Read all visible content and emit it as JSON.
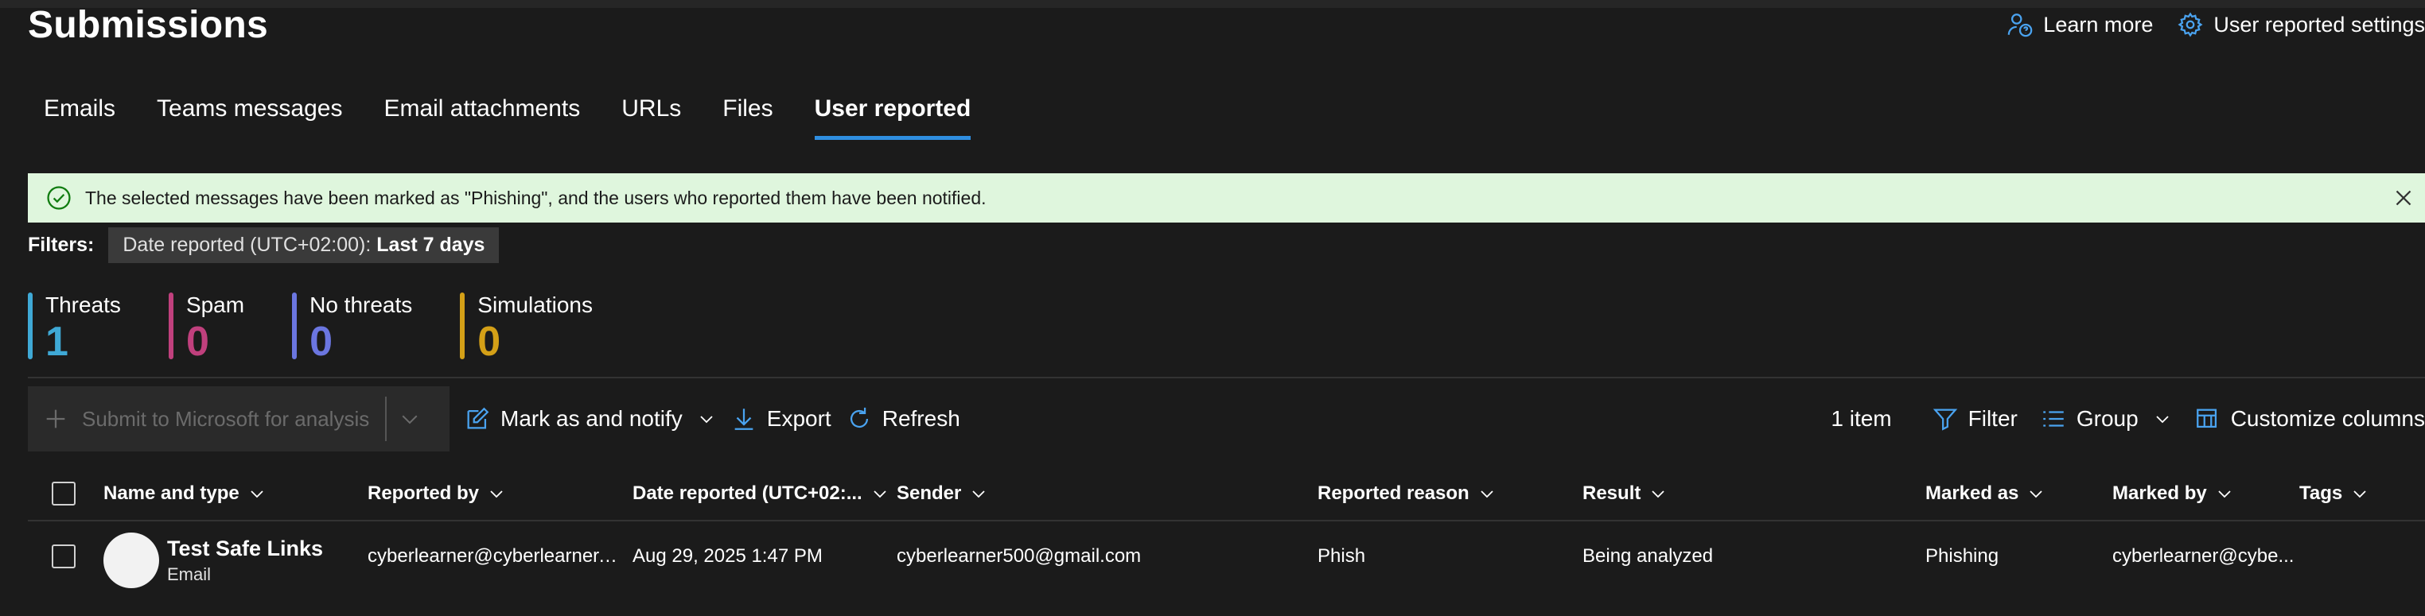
{
  "page": {
    "title": "Submissions"
  },
  "top_links": {
    "learn_more": "Learn more",
    "settings": "User reported settings"
  },
  "tabs": [
    {
      "label": "Emails",
      "active": false
    },
    {
      "label": "Teams messages",
      "active": false
    },
    {
      "label": "Email attachments",
      "active": false
    },
    {
      "label": "URLs",
      "active": false
    },
    {
      "label": "Files",
      "active": false
    },
    {
      "label": "User reported",
      "active": true
    }
  ],
  "banner": {
    "message": "The selected messages have been marked as \"Phishing\", and the users who reported them have been notified."
  },
  "filters": {
    "label": "Filters:",
    "chip_key": "Date reported (UTC+02:00):",
    "chip_value": "Last 7 days"
  },
  "stats": [
    {
      "label": "Threats",
      "value": "1",
      "color": "#3fa9d6"
    },
    {
      "label": "Spam",
      "value": "0",
      "color": "#c0407d"
    },
    {
      "label": "No threats",
      "value": "0",
      "color": "#6b76e0"
    },
    {
      "label": "Simulations",
      "value": "0",
      "color": "#d4a017"
    }
  ],
  "toolbar": {
    "submit": "Submit to Microsoft for analysis",
    "mark_notify": "Mark as and notify",
    "export": "Export",
    "refresh": "Refresh",
    "item_count": "1 item",
    "filter": "Filter",
    "group": "Group",
    "customize": "Customize columns"
  },
  "table": {
    "columns": [
      "Name and type",
      "Reported by",
      "Date reported (UTC+02:...",
      "Sender",
      "Reported reason",
      "Result",
      "Marked as",
      "Marked by",
      "Tags"
    ],
    "rows": [
      {
        "name": "Test Safe Links",
        "type": "Email",
        "reported_by": "cyberlearner@cyberlearner.o...",
        "date": "Aug 29, 2025 1:47 PM",
        "sender": "cyberlearner500@gmail.com",
        "reason": "Phish",
        "result": "Being analyzed",
        "marked_as": "Phishing",
        "marked_by": "cyberlearner@cybe..."
      }
    ]
  },
  "colors": {
    "accent": "#2f8ee0",
    "banner_bg": "#dff6dd",
    "banner_icon": "#107c10"
  }
}
